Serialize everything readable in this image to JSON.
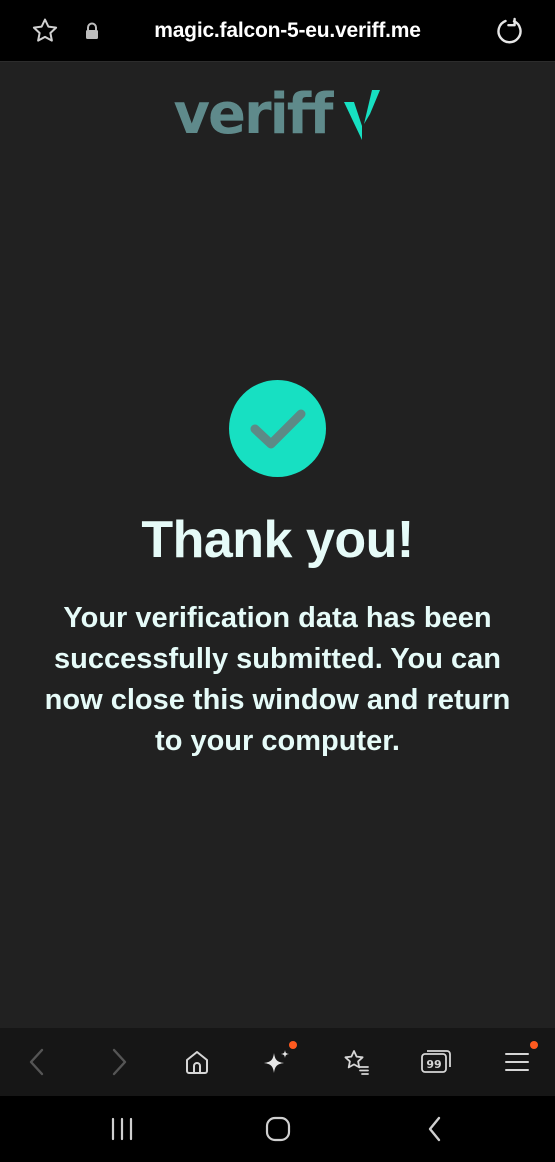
{
  "browser": {
    "url": "magic.falcon-5-eu.veriff.me",
    "icons": {
      "bookmark": "star-outline-icon",
      "secure": "lock-icon",
      "reload": "reload-icon"
    }
  },
  "page": {
    "logo_text": "veriff",
    "title": "Thank you!",
    "message": "Your verification data has been successfully submitted. You can now close this window and return to your computer."
  },
  "toolbar": {
    "items": [
      "back-icon",
      "forward-icon",
      "home-icon",
      "sparkle-icon",
      "bookmarks-icon",
      "tabs-icon",
      "menu-icon"
    ],
    "tabs_count": "99"
  },
  "colors": {
    "background": "#212121",
    "accent": "#17e0c2",
    "logo": "#5f8a8b",
    "text": "#e6fbf8",
    "notification_dot": "#ff5a1f"
  }
}
